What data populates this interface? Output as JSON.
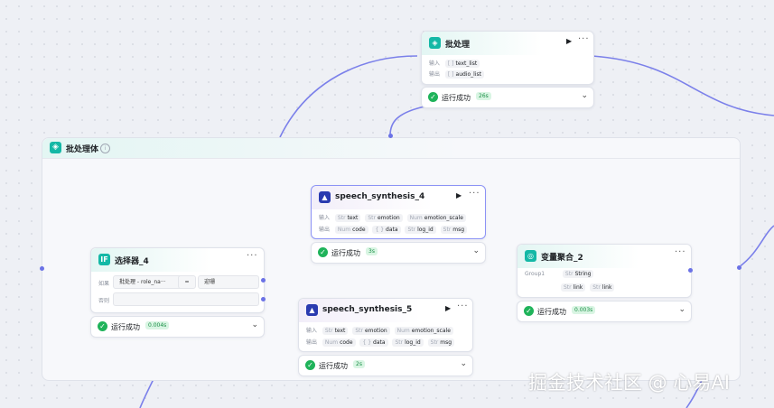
{
  "group": {
    "title": "批处理体"
  },
  "batch": {
    "title": "批处理",
    "in_label": "输入",
    "in_type": "[ ]",
    "in_value": "text_list",
    "out_label": "输出",
    "out_type": "[ ]",
    "out_value": "audio_list",
    "status": "运行成功",
    "time": "26s"
  },
  "selector": {
    "title": "选择器_4",
    "cond_label": "如果",
    "left_operand": "批处理 - role_na···",
    "operator": "=",
    "right_operand": "迎珊",
    "else_label": "否则",
    "status": "运行成功",
    "time": "0.004s"
  },
  "speech4": {
    "title": "speech_synthesis_4",
    "in_label": "输入",
    "inputs": [
      {
        "type": "Str",
        "name": "text"
      },
      {
        "type": "Str",
        "name": "emotion"
      },
      {
        "type": "Num",
        "name": "emotion_scale"
      }
    ],
    "out_label": "输出",
    "outputs": [
      {
        "type": "Num",
        "name": "code"
      },
      {
        "type": "{ }",
        "name": "data"
      },
      {
        "type": "Str",
        "name": "log_id"
      },
      {
        "type": "Str",
        "name": "msg"
      }
    ],
    "status": "运行成功",
    "time": "3s"
  },
  "speech5": {
    "title": "speech_synthesis_5",
    "in_label": "输入",
    "inputs": [
      {
        "type": "Str",
        "name": "text"
      },
      {
        "type": "Str",
        "name": "emotion"
      },
      {
        "type": "Num",
        "name": "emotion_scale"
      }
    ],
    "out_label": "输出",
    "outputs": [
      {
        "type": "Num",
        "name": "code"
      },
      {
        "type": "{ }",
        "name": "data"
      },
      {
        "type": "Str",
        "name": "log_id"
      },
      {
        "type": "Str",
        "name": "msg"
      }
    ],
    "status": "运行成功",
    "time": "2s"
  },
  "aggregator": {
    "title": "变量聚合_2",
    "group_label": "Group1",
    "group_type": "Str",
    "group_value": "String",
    "items": [
      {
        "type": "Str",
        "name": "link"
      },
      {
        "type": "Str",
        "name": "link"
      }
    ],
    "status": "运行成功",
    "time": "0.003s"
  },
  "watermark": "掘金技术社区 @ 心易AI",
  "colors": {
    "accent": "#6b72e6",
    "success": "#1fb35a",
    "teal": "#14b8a6"
  }
}
